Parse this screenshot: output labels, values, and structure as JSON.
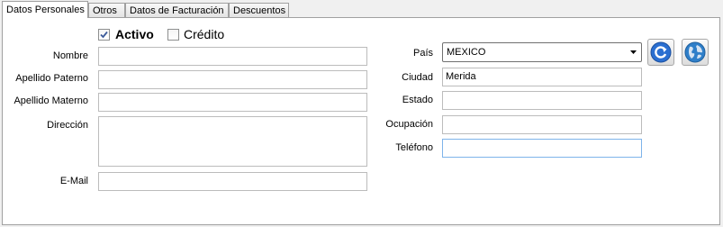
{
  "tabs": [
    {
      "label": "Datos Personales"
    },
    {
      "label": "Otros"
    },
    {
      "label": "Datos de Facturación"
    },
    {
      "label": "Descuentos"
    }
  ],
  "form": {
    "activo": {
      "label": "Activo",
      "checked": true
    },
    "credito": {
      "label": "Crédito",
      "checked": false
    },
    "left": {
      "nombre_label": "Nombre",
      "nombre_value": "",
      "apellido_paterno_label": "Apellido Paterno",
      "apellido_paterno_value": "",
      "apellido_materno_label": "Apellido Materno",
      "apellido_materno_value": "",
      "direccion_label": "Dirección",
      "direccion_value": "",
      "email_label": "E-Mail",
      "email_value": ""
    },
    "right": {
      "pais_label": "País",
      "pais_value": "MEXICO",
      "ciudad_label": "Ciudad",
      "ciudad_value": "Merida",
      "estado_label": "Estado",
      "estado_value": "",
      "ocupacion_label": "Ocupación",
      "ocupacion_value": "",
      "telefono_label": "Teléfono",
      "telefono_value": ""
    }
  },
  "icons": {
    "refresh": "refresh-icon",
    "globe": "globe-icon"
  },
  "colors": {
    "checkmark": "#3c5a9a",
    "refresh_blue": "#2a6fd1",
    "globe_blue": "#2f7fc9",
    "focus_border": "#7eb4ea"
  }
}
